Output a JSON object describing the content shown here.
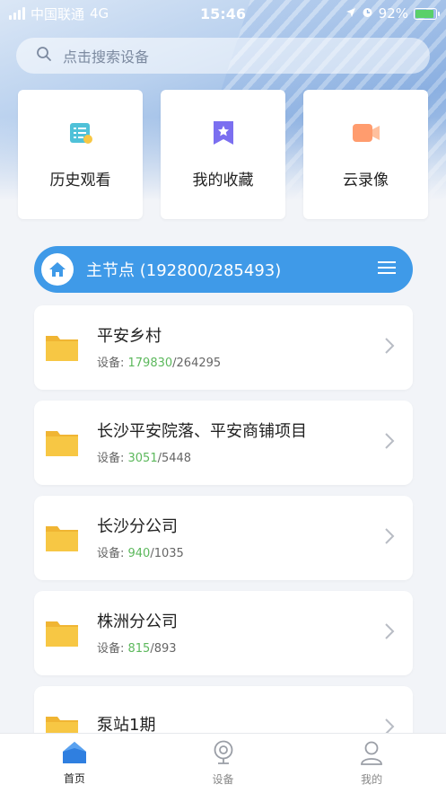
{
  "status_bar": {
    "carrier": "中国联通",
    "network": "4G",
    "time": "15:46",
    "battery": "92%"
  },
  "search": {
    "placeholder": "点击搜索设备"
  },
  "shortcuts": [
    {
      "label": "历史观看",
      "icon": "history-list-icon"
    },
    {
      "label": "我的收藏",
      "icon": "favorite-star-icon"
    },
    {
      "label": "云录像",
      "icon": "cloud-recording-icon"
    }
  ],
  "main_node": {
    "title": "主节点 (192800/285493)"
  },
  "folders": [
    {
      "name": "平安乡村",
      "device_prefix": "设备: ",
      "online": "179830",
      "total": "/264295"
    },
    {
      "name": "长沙平安院落、平安商铺项目",
      "device_prefix": "设备: ",
      "online": "3051",
      "total": "/5448"
    },
    {
      "name": "长沙分公司",
      "device_prefix": "设备: ",
      "online": "940",
      "total": "/1035"
    },
    {
      "name": "株洲分公司",
      "device_prefix": "设备: ",
      "online": "815",
      "total": "/893"
    },
    {
      "name": "泵站1期",
      "device_prefix": "",
      "online": "",
      "total": ""
    }
  ],
  "tabs": [
    {
      "label": "首页",
      "active": true
    },
    {
      "label": "设备",
      "active": false
    },
    {
      "label": "我的",
      "active": false
    }
  ],
  "colors": {
    "accent": "#3f9ae8",
    "online": "#5cb85c",
    "folder": "#f7c744"
  }
}
